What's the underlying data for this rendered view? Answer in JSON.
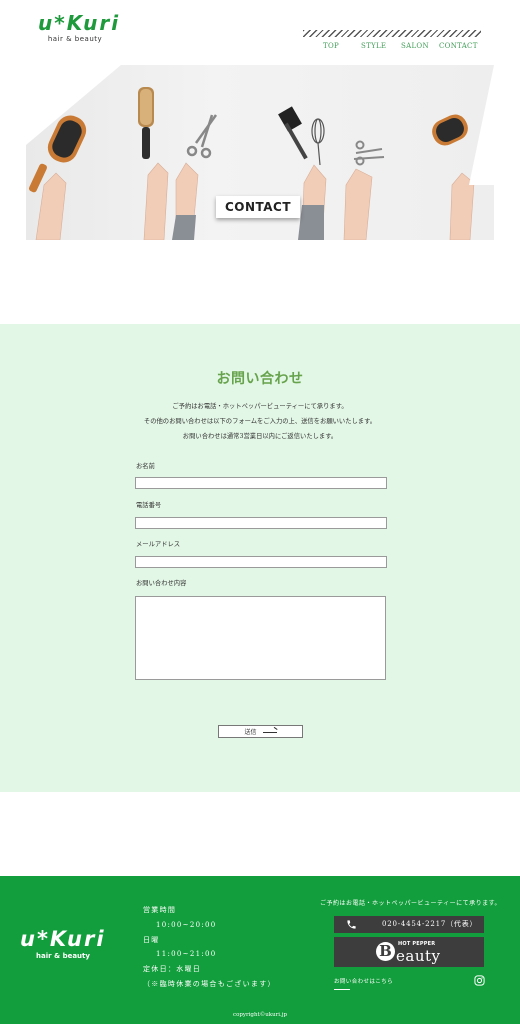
{
  "header": {
    "logo_main": "u*Kuri",
    "logo_sub": "hair & beauty",
    "nav": [
      "TOP",
      "STYLE",
      "SALON",
      "CONTACT"
    ]
  },
  "hero": {
    "label": "CONTACT"
  },
  "form": {
    "title": "お問い合わせ",
    "intro": [
      "ご予約はお電話・ホットペッパービューティーにて承ります。",
      "その他のお問い合わせは以下のフォームをご入力の上、送信をお願いいたします。",
      "お問い合わせは通常3営業日以内にご返信いたします。"
    ],
    "fields": {
      "name_label": "お名前",
      "phone_label": "電話番号",
      "email_label": "メールアドレス",
      "message_label": "お問い合わせ内容"
    },
    "submit_label": "送信"
  },
  "footer": {
    "logo_main": "u*Kuri",
    "logo_sub": "hair & beauty",
    "hours": {
      "business_hours_label": "営業時間",
      "business_hours": "10:00~20:00",
      "sunday_label": "日曜",
      "sunday_hours": "11:00~21:00",
      "closed_day": "定休日：水曜日",
      "closed_note": "（※臨時休業の場合もございます）"
    },
    "reserve_note": "ご予約はお電話・ホットペッパービューティーにて承ります。",
    "phone": "020-4454-2217（代表）",
    "hotpepper_small": "HOT PEPPER",
    "hotpepper_big": "eauty",
    "hotpepper_initial": "B",
    "contact_link": "お問い合わせはこちら",
    "copyright": "copyright©ukuri.jp"
  },
  "colors": {
    "brand_green": "#1e9a3c",
    "footer_green": "#129e3c",
    "form_bg": "#e3f7e6",
    "title_green": "#66a34c",
    "dark_box": "#3d3d3d"
  }
}
